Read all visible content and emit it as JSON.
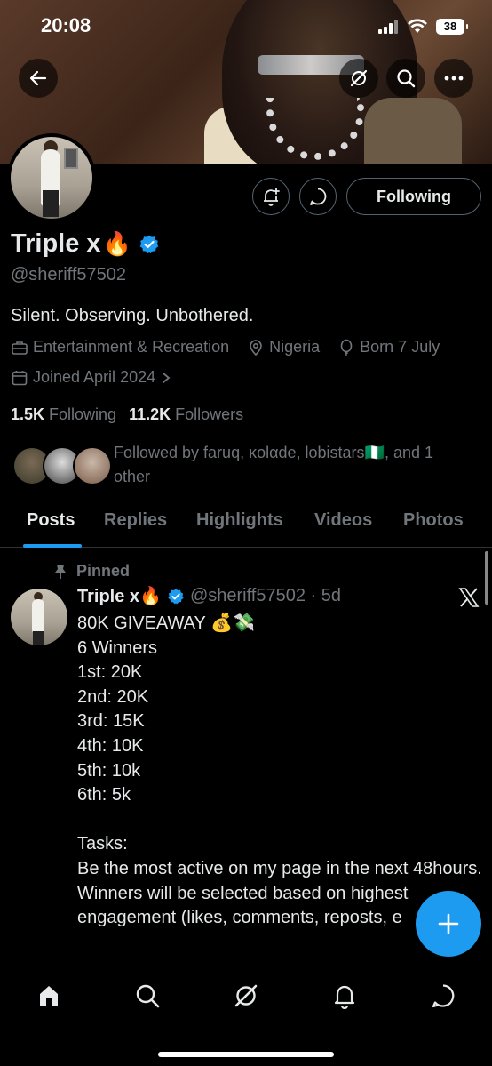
{
  "status_bar": {
    "time": "20:08",
    "battery": "38"
  },
  "profile": {
    "display_name": "Triple x",
    "name_emoji": "🔥",
    "handle": "@sheriff57502",
    "bio": "Silent. Observing. Unbothered.",
    "category": "Entertainment & Recreation",
    "location": "Nigeria",
    "birthday": "Born 7 July",
    "joined": "Joined April 2024",
    "following_count": "1.5K",
    "following_label": "Following",
    "followers_count": "11.2K",
    "followers_label": "Followers",
    "followed_by": "Followed by faruq, ĸolαde, lobistars🇳🇬, and 1 other",
    "follow_button_label": "Following"
  },
  "tabs": [
    {
      "label": "Posts",
      "active": true
    },
    {
      "label": "Replies"
    },
    {
      "label": "Highlights"
    },
    {
      "label": "Videos"
    },
    {
      "label": "Photos"
    }
  ],
  "pinned_post": {
    "pinned_label": "Pinned",
    "author_name": "Triple x🔥",
    "author_handle": "@sheriff57502 · 5d",
    "body": "80K GIVEAWAY 💰💸\n6 Winners\n1st: 20K\n2nd: 20K\n3rd: 15K\n4th: 10K\n5th: 10k\n6th: 5k\n\nTasks:\nBe the most active on my page in the next 48hours.\nWinners will be selected based on highest engagement (likes, comments, reposts, e"
  },
  "colors": {
    "accent": "#1d9bf0",
    "muted": "#71767b",
    "text": "#e7e9ea",
    "background": "#000000"
  },
  "icons": [
    "back-arrow-icon",
    "grok-icon",
    "search-icon",
    "more-icon",
    "notification-bell-plus-icon",
    "message-icon",
    "verified-badge-icon",
    "briefcase-icon",
    "location-pin-icon",
    "balloon-icon",
    "calendar-icon",
    "pin-icon",
    "x-logo-icon",
    "plus-icon",
    "home-icon",
    "bell-icon"
  ]
}
